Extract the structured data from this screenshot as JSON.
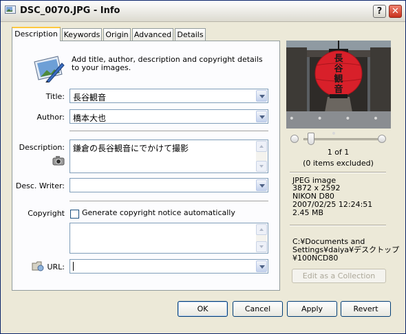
{
  "window": {
    "title": "DSC_0070.JPG - Info",
    "help_label": "?",
    "close_label": "✕"
  },
  "tabs": [
    {
      "label": "Description",
      "active": true
    },
    {
      "label": "Keywords",
      "active": false
    },
    {
      "label": "Origin",
      "active": false
    },
    {
      "label": "Advanced",
      "active": false
    },
    {
      "label": "Details",
      "active": false
    }
  ],
  "description_tab": {
    "intro": "Add title, author, description and copyright details to your images.",
    "title_label": "Title:",
    "title_value": "長谷観音",
    "author_label": "Author:",
    "author_value": "橋本大也",
    "description_label": "Description:",
    "description_value": "鎌倉の長谷観音にでかけて撮影",
    "desc_writer_label": "Desc. Writer:",
    "desc_writer_value": "",
    "copyright_label": "Copyright",
    "copyright_checkbox_label": "Generate copyright notice automatically",
    "copyright_checked": false,
    "copyright_value": "",
    "url_label": "URL:",
    "url_value": ""
  },
  "preview": {
    "dots": "• • • • •",
    "counter": "1 of 1",
    "excluded": "(0 items excluded)",
    "file_type": "JPEG image",
    "dimensions": "3872 x 2592",
    "camera": "NIKON D80",
    "datetime": "2007/02/25 12:24:51",
    "size": "2.45 MB",
    "path_lines": [
      "C:¥Documents and",
      "Settings¥daiya¥デスクトップ",
      "¥100NCD80"
    ],
    "lantern_text": "長谷観音",
    "edit_collection_label": "Edit as a Collection"
  },
  "buttons": {
    "ok": "OK",
    "cancel": "Cancel",
    "apply": "Apply",
    "revert": "Revert"
  },
  "colors": {
    "accent_tab": "#ffc83c",
    "lantern_red": "#d8202a",
    "close_red": "#c8301c"
  }
}
